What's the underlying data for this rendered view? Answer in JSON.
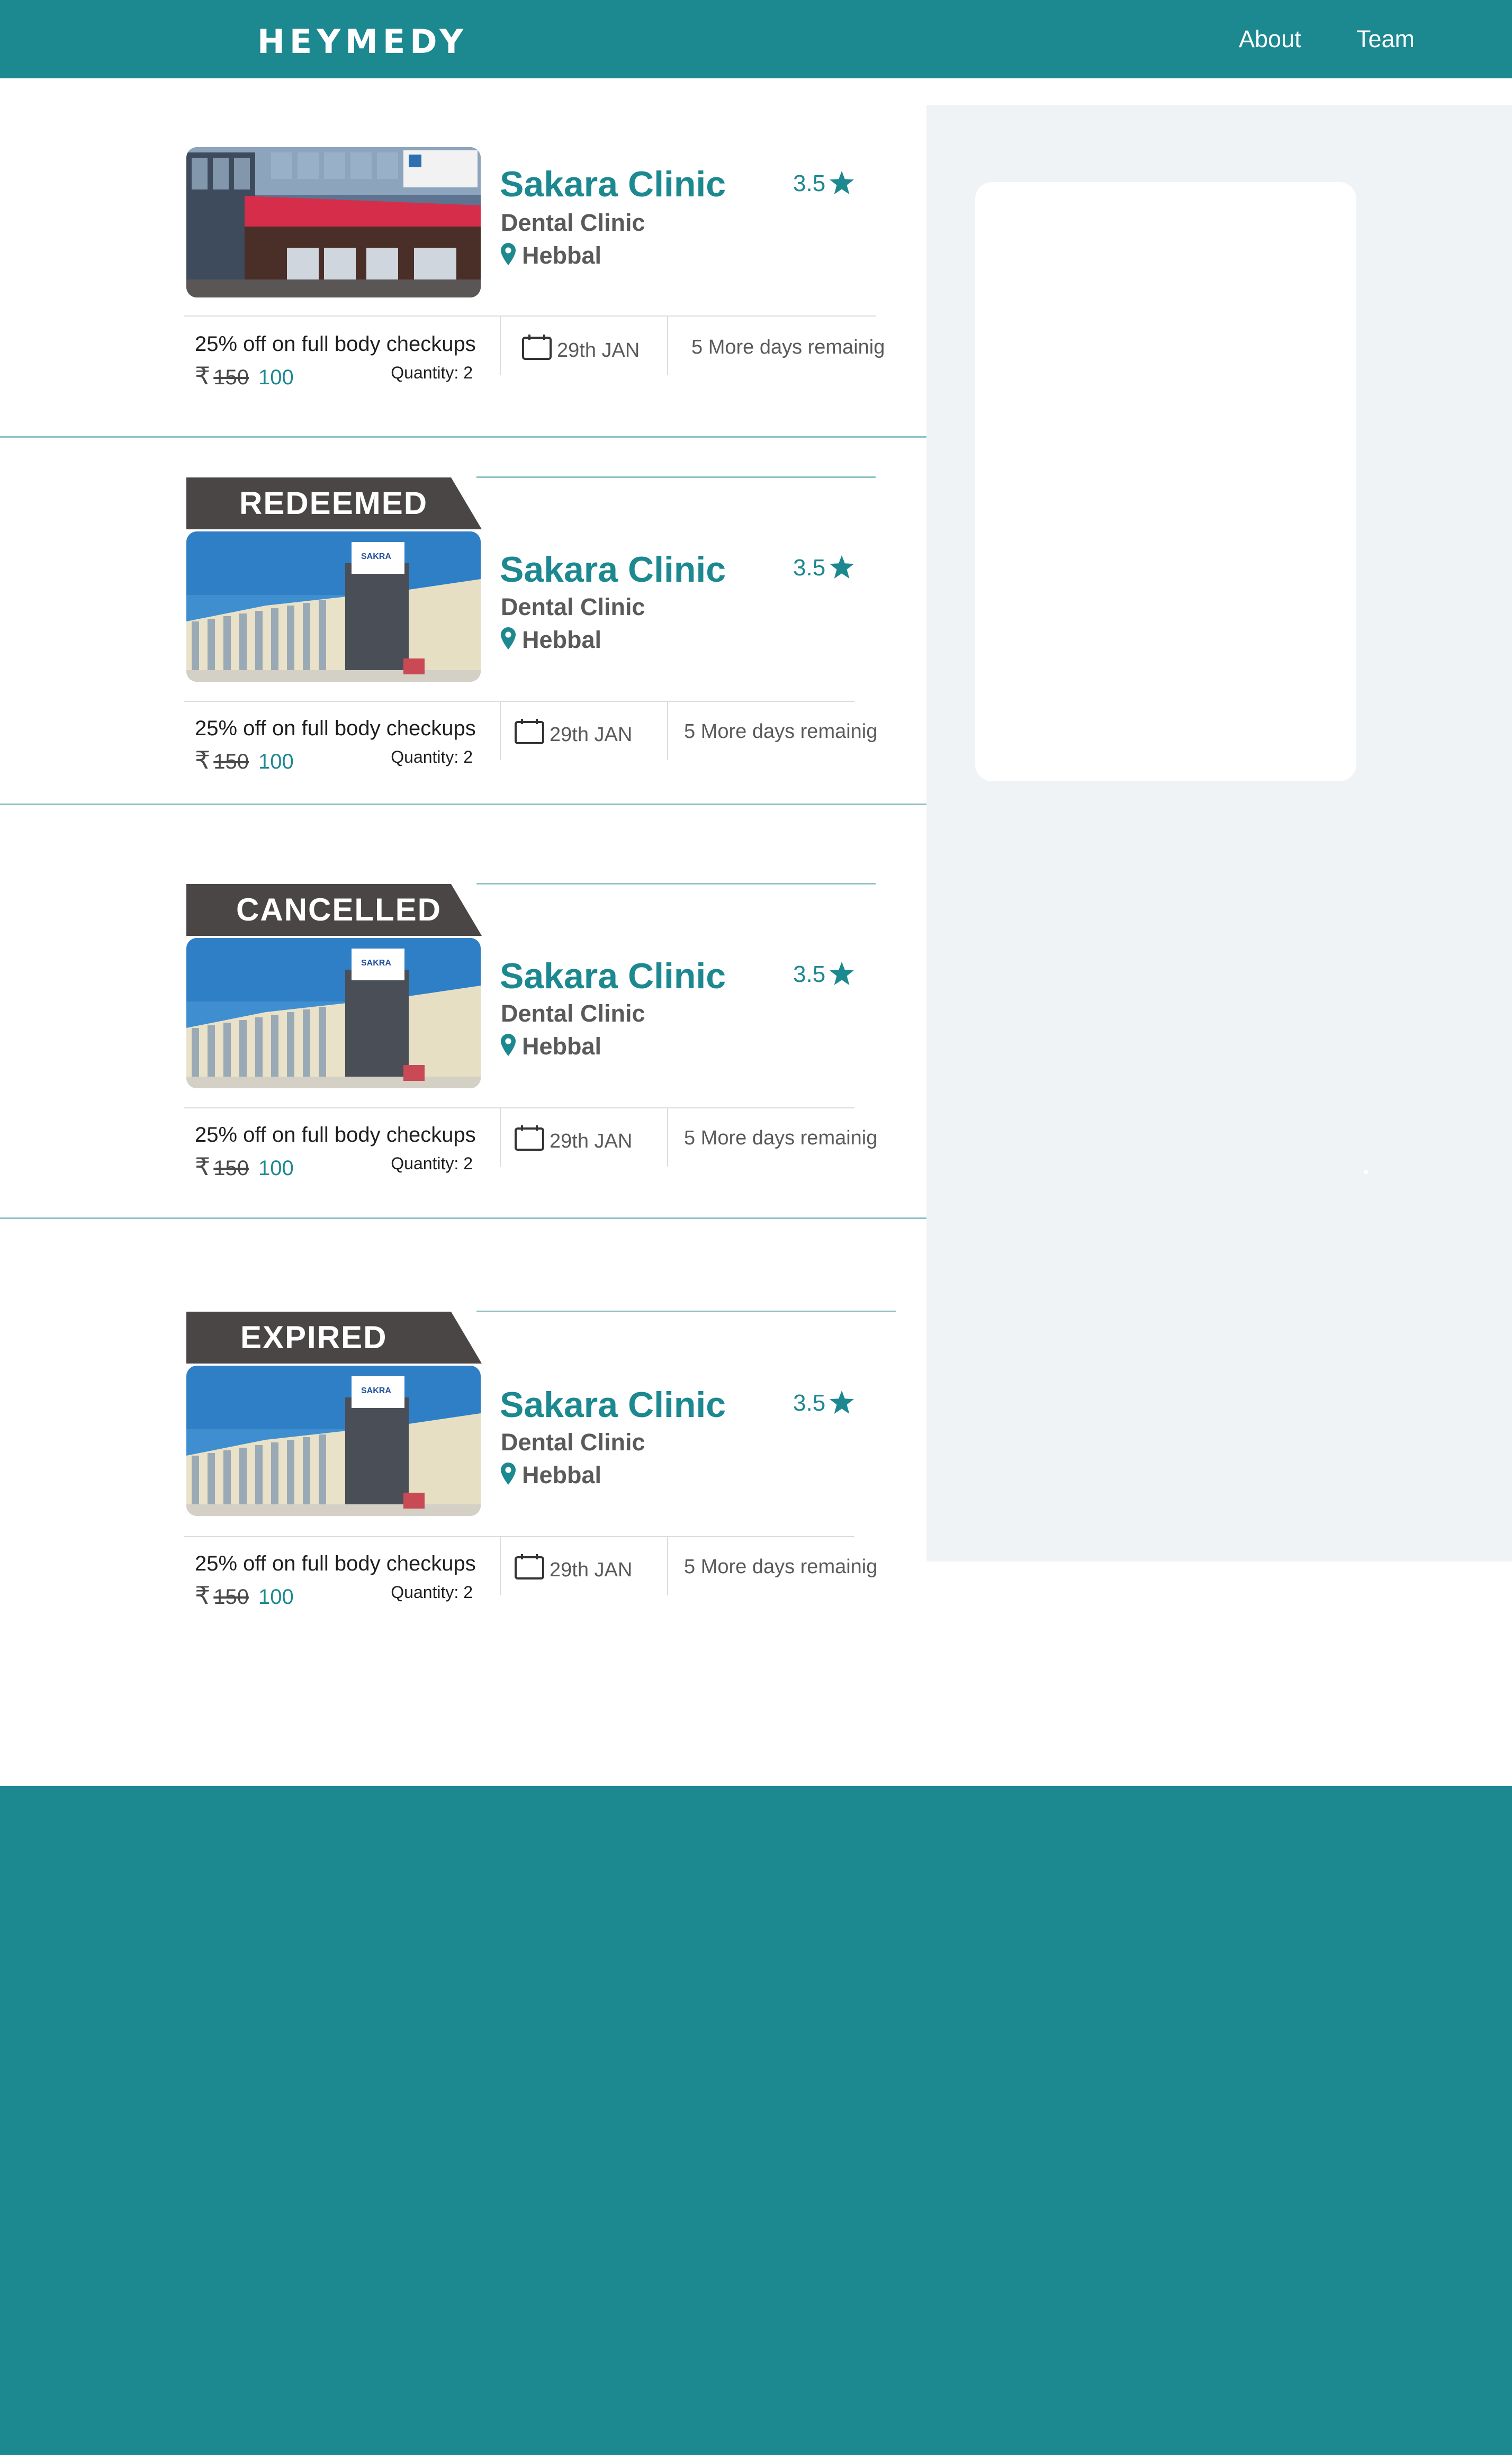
{
  "header": {
    "logo": "HEYMEDY",
    "nav": [
      {
        "label": "About"
      },
      {
        "label": "Team"
      }
    ]
  },
  "colors": {
    "brand": "#1c8890",
    "tag_bg": "#4a4646",
    "side_bg": "#eff3f5"
  },
  "icons": {
    "rating": "star-icon",
    "location": "map-pin-icon",
    "date": "calendar-icon",
    "currency": "rupee-icon"
  },
  "coupons": [
    {
      "status": "",
      "clinic_name": "Sakara Clinic",
      "clinic_type": "Dental Clinic",
      "location": "Hebbal",
      "rating": "3.5",
      "offer": "25% off on full body checkups",
      "currency": "₹",
      "old_price": "150",
      "new_price": "100",
      "quantity": "Quantity: 2",
      "date": "29th JAN",
      "remaining": "5 More days remainig"
    },
    {
      "status": "REDEEMED",
      "clinic_name": "Sakara Clinic",
      "clinic_type": "Dental Clinic",
      "location": "Hebbal",
      "rating": "3.5",
      "offer": "25% off on full body checkups",
      "currency": "₹",
      "old_price": "150",
      "new_price": "100",
      "quantity": "Quantity: 2",
      "date": "29th JAN",
      "remaining": "5 More days remainig"
    },
    {
      "status": "CANCELLED",
      "clinic_name": "Sakara Clinic",
      "clinic_type": "Dental Clinic",
      "location": "Hebbal",
      "rating": "3.5",
      "offer": "25% off on full body checkups",
      "currency": "₹",
      "old_price": "150",
      "new_price": "100",
      "quantity": "Quantity: 2",
      "date": "29th JAN",
      "remaining": "5 More days remainig"
    },
    {
      "status": "EXPIRED",
      "clinic_name": "Sakara Clinic",
      "clinic_type": "Dental Clinic",
      "location": "Hebbal",
      "rating": "3.5",
      "offer": "25% off on full body checkups",
      "currency": "₹",
      "old_price": "150",
      "new_price": "100",
      "quantity": "Quantity: 2",
      "date": "29th JAN",
      "remaining": "5 More days remainig"
    }
  ]
}
